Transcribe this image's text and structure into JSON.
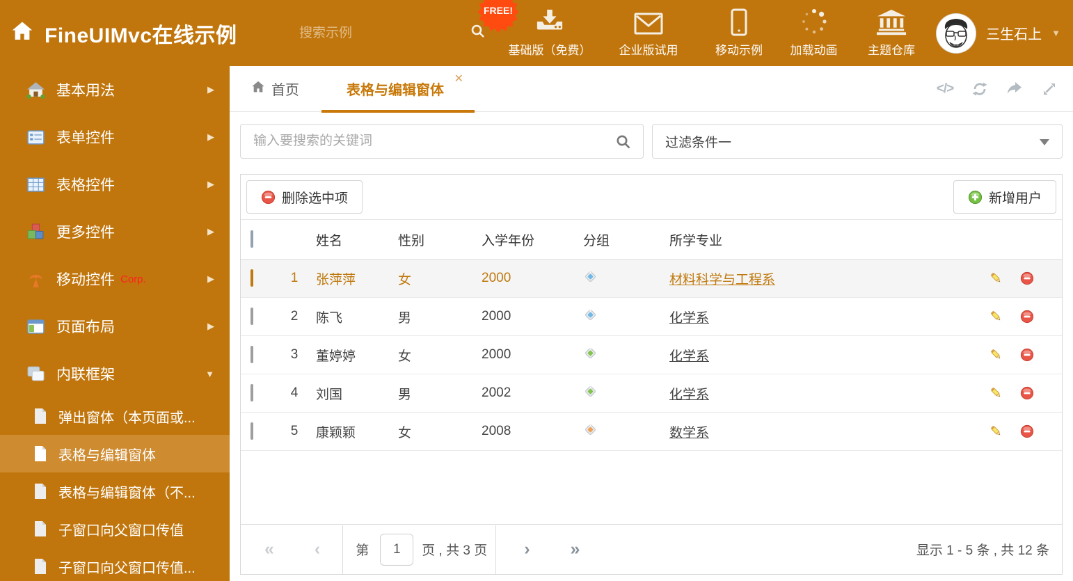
{
  "colors": {
    "accent": "#C1760D",
    "accent_light": "#CE8B30",
    "tab_active": "#C8790A",
    "free_badge": "#FF4B0F",
    "selected_row_text": "#C0790E"
  },
  "header": {
    "title": "FineUIMvc在线示例",
    "search_placeholder": "搜索示例",
    "free_badge": "FREE!",
    "nav_items": [
      {
        "label": "基础版（免费）",
        "icon": "download-icon"
      },
      {
        "label": "企业版试用",
        "icon": "envelope-icon"
      },
      {
        "label": "移动示例",
        "icon": "phone-icon"
      },
      {
        "label": "加载动画",
        "icon": "spinner-icon"
      },
      {
        "label": "主题仓库",
        "icon": "bank-icon"
      }
    ],
    "user_name": "三生石上"
  },
  "sidebar": {
    "items": [
      {
        "label": "基本用法"
      },
      {
        "label": "表单控件"
      },
      {
        "label": "表格控件"
      },
      {
        "label": "更多控件"
      },
      {
        "label": "移动控件",
        "badge": "Corp."
      },
      {
        "label": "页面布局"
      },
      {
        "label": "内联框架"
      }
    ],
    "subitems": [
      {
        "label": "弹出窗体（本页面或..."
      },
      {
        "label": "表格与编辑窗体"
      },
      {
        "label": "表格与编辑窗体（不..."
      },
      {
        "label": "子窗口向父窗口传值"
      },
      {
        "label": "子窗口向父窗口传值..."
      }
    ]
  },
  "tabs": {
    "home": "首页",
    "active": "表格与编辑窗体"
  },
  "filters": {
    "search_placeholder": "输入要搜索的关键词",
    "filter_value": "过滤条件一"
  },
  "toolbar": {
    "delete_label": "删除选中项",
    "add_label": "新增用户"
  },
  "table": {
    "columns": [
      "姓名",
      "性别",
      "入学年份",
      "分组",
      "所学专业"
    ],
    "rows": [
      {
        "index": "1",
        "name": "张萍萍",
        "gender": "女",
        "year": "2000",
        "tag_color": "#6FB8E8",
        "major": "材料科学与工程系"
      },
      {
        "index": "2",
        "name": "陈飞",
        "gender": "男",
        "year": "2000",
        "tag_color": "#6FB8E8",
        "major": "化学系"
      },
      {
        "index": "3",
        "name": "董婷婷",
        "gender": "女",
        "year": "2000",
        "tag_color": "#84C34E",
        "major": "化学系"
      },
      {
        "index": "4",
        "name": "刘国",
        "gender": "男",
        "year": "2002",
        "tag_color": "#84C34E",
        "major": "化学系"
      },
      {
        "index": "5",
        "name": "康颖颖",
        "gender": "女",
        "year": "2008",
        "tag_color": "#F0A155",
        "major": "数学系"
      }
    ]
  },
  "pagination": {
    "page_prefix": "第",
    "current_page": "1",
    "page_suffix": "页 , 共 3 页",
    "summary": "显示 1 - 5 条 , 共 12 条"
  }
}
